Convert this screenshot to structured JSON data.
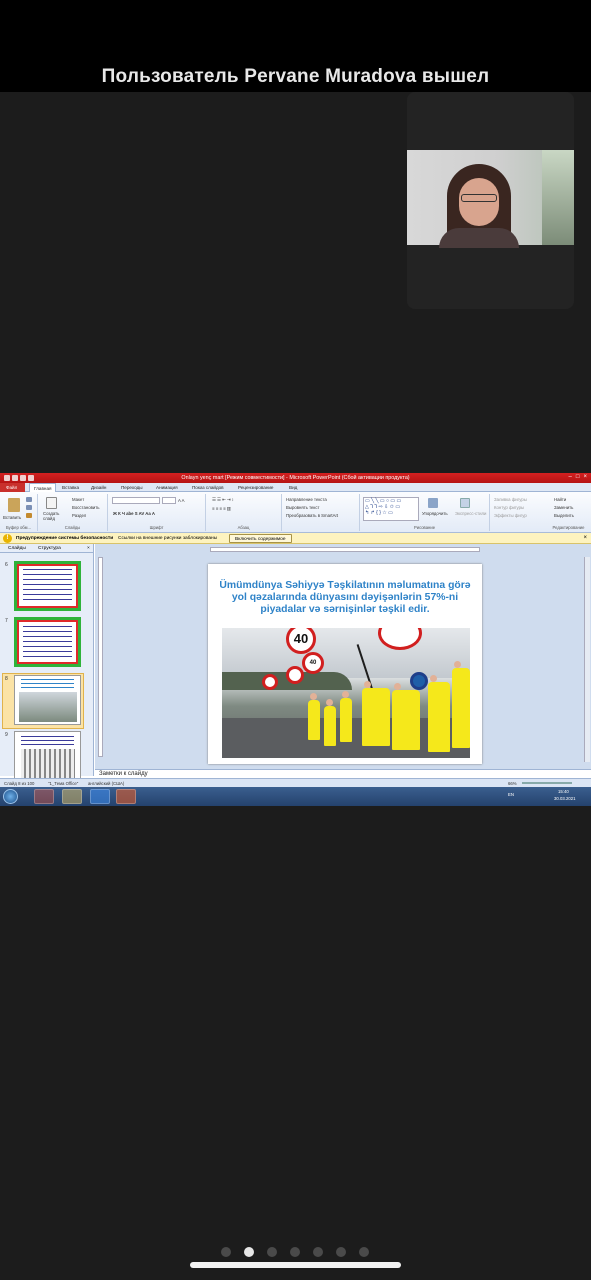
{
  "notification": {
    "text": "Пользователь Pervane Muradova вышел"
  },
  "participant": {
    "video": "camera-feed"
  },
  "powerpoint": {
    "window_title": "Onlayn yenç mart [Режим совместимости] - Microsoft PowerPoint (Сбой активации продукта)",
    "tabs": [
      "Файл",
      "Главная",
      "Вставка",
      "Дизайн",
      "Переходы",
      "Анимация",
      "Показ слайдов",
      "Рецензирование",
      "Вид"
    ],
    "ribbon": {
      "paste": "Вставить",
      "clipboard": "Буфер обм...",
      "new_slide": "Создать слайд",
      "layout": "Макет",
      "reset": "Восстановить",
      "section": "Раздел",
      "slides_group": "Слайды",
      "font_group": "Шрифт",
      "paragraph_group": "Абзац",
      "text_direction": "Направление текста",
      "align_text": "Выровнять текст",
      "smartart": "Преобразовать в SmartArt",
      "arrange": "Упорядочить",
      "quick_styles": "Экспресс-стили",
      "shape_fill": "Заливка фигуры",
      "shape_outline": "Контур фигуры",
      "shape_effects": "Эффекты фигур",
      "drawing_group": "Рисование",
      "find": "Найти",
      "replace": "Заменить",
      "select": "Выделить",
      "editing_group": "Редактирование"
    },
    "security_bar": {
      "title": "Предупреждение системы безопасности",
      "message": "Ссылки на внешние рисунки заблокированы",
      "button": "Включить содержимое"
    },
    "left_pane": {
      "tab_slides": "Слайды",
      "tab_outline": "Структура"
    },
    "thumbnails": [
      {
        "num": "6"
      },
      {
        "num": "7"
      },
      {
        "num": "8"
      },
      {
        "num": "9"
      }
    ],
    "slide": {
      "heading": "Ümümdünya Səhiyyə Təşkilatının məlumatına görə yol qəzalarında dünyasını dəyişənlərin 57%-ni piyadalar və sərnişinlər təşkil edir.",
      "signs": [
        "40",
        "40"
      ]
    },
    "notes_placeholder": "Заметки к слайду",
    "status": {
      "slide": "Слайд 8 из 100",
      "theme": "\"1_Тема Office\"",
      "language": "английский (США)",
      "zoom": "66%"
    },
    "taskbar": {
      "lang": "EN",
      "time": "15:40",
      "date": "30.03.2021"
    }
  },
  "pager": {
    "count": 7,
    "active": 1
  }
}
